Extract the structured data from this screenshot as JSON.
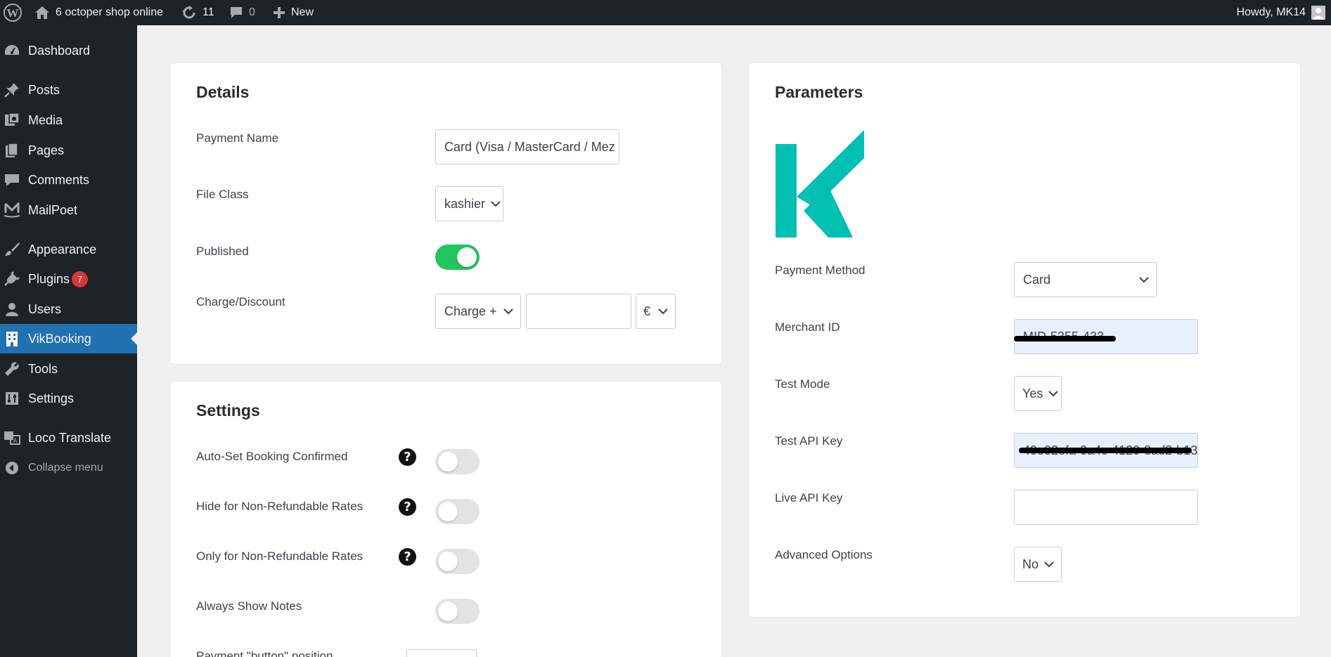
{
  "admin_bar": {
    "site_name": "6 octoper shop online",
    "updates_count": "11",
    "comments_count": "0",
    "new_label": "New",
    "howdy": "Howdy, MK14"
  },
  "sidebar": {
    "items": [
      {
        "label": "Dashboard",
        "icon": "dashboard-icon"
      },
      {
        "label": "Posts",
        "icon": "pin-icon"
      },
      {
        "label": "Media",
        "icon": "media-icon"
      },
      {
        "label": "Pages",
        "icon": "pages-icon"
      },
      {
        "label": "Comments",
        "icon": "comment-icon"
      },
      {
        "label": "MailPoet",
        "icon": "mailpoet-icon"
      },
      {
        "label": "Appearance",
        "icon": "brush-icon"
      },
      {
        "label": "Plugins",
        "icon": "plug-icon",
        "badge": "7"
      },
      {
        "label": "Users",
        "icon": "user-icon"
      },
      {
        "label": "VikBooking",
        "icon": "building-icon",
        "current": true
      },
      {
        "label": "Tools",
        "icon": "wrench-icon"
      },
      {
        "label": "Settings",
        "icon": "settings-icon"
      },
      {
        "label": "Loco Translate",
        "icon": "translate-icon"
      },
      {
        "label": "Collapse menu",
        "icon": "collapse-icon"
      }
    ]
  },
  "details": {
    "title": "Details",
    "payment_name_label": "Payment Name",
    "payment_name_value": "Card (Visa / MasterCard / Mez",
    "file_class_label": "File Class",
    "file_class_value": "kashier",
    "published_label": "Published",
    "published": true,
    "charge_label": "Charge/Discount",
    "charge_type_value": "Charge +",
    "charge_amount_value": "",
    "currency_value": "€"
  },
  "settings": {
    "title": "Settings",
    "rows": [
      {
        "label": "Auto-Set Booking Confirmed",
        "help": true,
        "on": false
      },
      {
        "label": "Hide for Non-Refundable Rates",
        "help": true,
        "on": false
      },
      {
        "label": "Only for Non-Refundable Rates",
        "help": true,
        "on": false
      },
      {
        "label": "Always Show Notes",
        "help": false,
        "on": false
      }
    ],
    "payment_button_label": "Payment \"button\" position"
  },
  "parameters": {
    "title": "Parameters",
    "logo_letter": "K",
    "logo_color": "#00bfb3",
    "payment_method_label": "Payment Method",
    "payment_method_value": "Card",
    "merchant_id_label": "Merchant ID",
    "merchant_id_value": "MID-5355-433",
    "test_mode_label": "Test Mode",
    "test_mode_value": "Yes",
    "test_api_key_label": "Test API Key",
    "test_api_key_value": "49e02efa-0a4c-4120-8ad2-b13",
    "live_api_key_label": "Live API Key",
    "live_api_key_value": "",
    "advanced_options_label": "Advanced Options",
    "advanced_options_value": "No"
  },
  "colors": {
    "admin_bar_bg": "#1d2327",
    "menu_current": "#2271b1",
    "toggle_on": "#22c55e",
    "badge": "#d63638"
  }
}
